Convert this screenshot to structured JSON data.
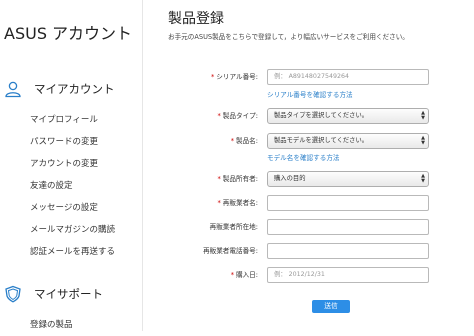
{
  "sidebar": {
    "brand": "ASUS アカウント",
    "account_section": {
      "label": "マイアカウント",
      "icon": "user-icon",
      "items": [
        {
          "label": "マイプロフィール"
        },
        {
          "label": "パスワードの変更"
        },
        {
          "label": "アカウントの変更"
        },
        {
          "label": "友達の設定"
        },
        {
          "label": "メッセージの設定"
        },
        {
          "label": "メールマガジンの購読"
        },
        {
          "label": "認証メールを再送する"
        }
      ]
    },
    "support_section": {
      "label": "マイサポート",
      "icon": "shield-icon",
      "items": [
        {
          "label": "登録の製品"
        }
      ]
    }
  },
  "main": {
    "title": "製品登録",
    "subtitle": "お手元のASUS製品をこちらで登録して，より幅広いサービスをご利用ください。",
    "form": {
      "serial": {
        "label": "シリアル番号:",
        "required": "*",
        "placeholder": "例： A89148027549264",
        "help": "シリアル番号を確認する方法"
      },
      "product_type": {
        "label": "製品タイプ:",
        "required": "*",
        "value": "製品タイプを選択してください。"
      },
      "product_name": {
        "label": "製品名:",
        "required": "*",
        "value": "製品モデルを選択してください。",
        "help": "モデル名を確認する方法"
      },
      "owner": {
        "label": "製品所有者:",
        "required": "*",
        "value": "購入の目的"
      },
      "reseller": {
        "label": "再販業者名:",
        "required": "*",
        "value": ""
      },
      "reseller_address": {
        "label": "再販業者所在地:",
        "value": ""
      },
      "reseller_phone": {
        "label": "再販業者電話番号:",
        "value": ""
      },
      "purchase_date": {
        "label": "購入日:",
        "required": "*",
        "placeholder": "例： 2012/12/31"
      },
      "submit_label": "送信"
    }
  },
  "colors": {
    "link": "#2a7fc9",
    "button": "#2d8ee6",
    "icon": "#2a7fc9"
  }
}
